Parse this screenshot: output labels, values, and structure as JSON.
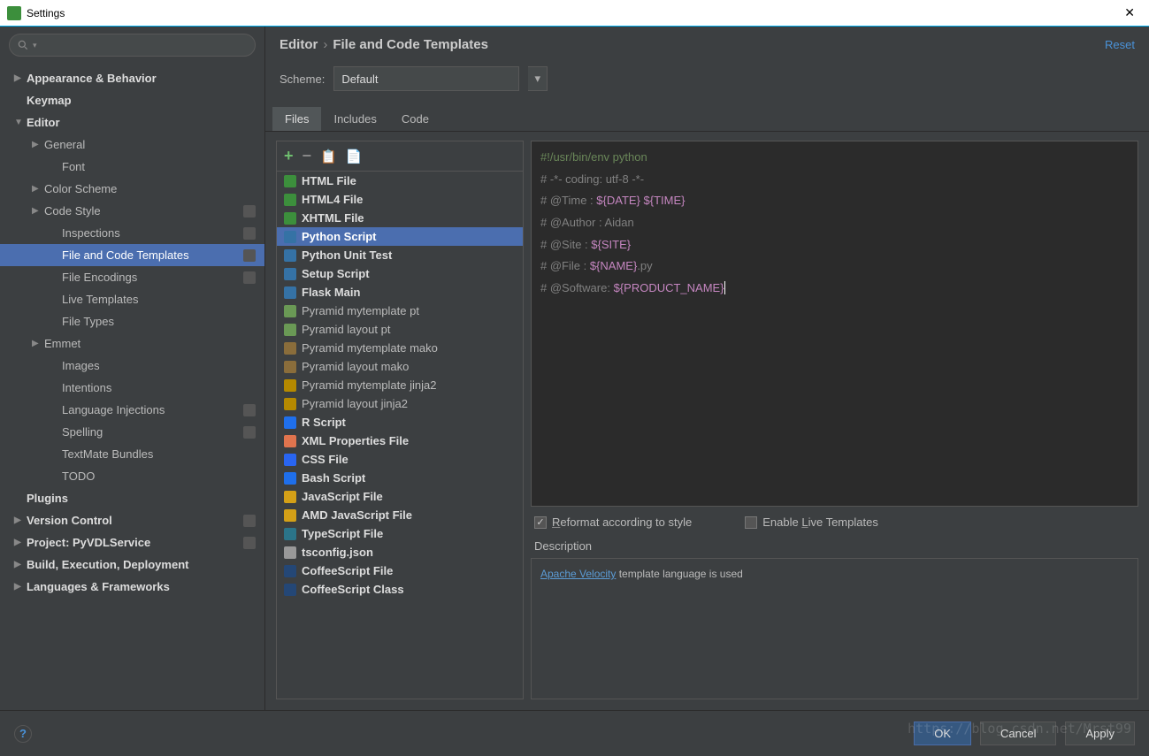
{
  "window": {
    "title": "Settings"
  },
  "search": {
    "placeholder": ""
  },
  "tree": [
    {
      "label": "Appearance & Behavior",
      "lvl": 1,
      "arrow": "▶",
      "bold": true
    },
    {
      "label": "Keymap",
      "lvl": 1,
      "arrow": "",
      "bold": true
    },
    {
      "label": "Editor",
      "lvl": 1,
      "arrow": "▼",
      "bold": true
    },
    {
      "label": "General",
      "lvl": 2,
      "arrow": "▶"
    },
    {
      "label": "Font",
      "lvl": 3,
      "arrow": ""
    },
    {
      "label": "Color Scheme",
      "lvl": 2,
      "arrow": "▶"
    },
    {
      "label": "Code Style",
      "lvl": 2,
      "arrow": "▶",
      "badge": true
    },
    {
      "label": "Inspections",
      "lvl": 3,
      "arrow": "",
      "badge": true
    },
    {
      "label": "File and Code Templates",
      "lvl": 3,
      "arrow": "",
      "badge": true,
      "selected": true
    },
    {
      "label": "File Encodings",
      "lvl": 3,
      "arrow": "",
      "badge": true
    },
    {
      "label": "Live Templates",
      "lvl": 3,
      "arrow": ""
    },
    {
      "label": "File Types",
      "lvl": 3,
      "arrow": ""
    },
    {
      "label": "Emmet",
      "lvl": 2,
      "arrow": "▶"
    },
    {
      "label": "Images",
      "lvl": 3,
      "arrow": ""
    },
    {
      "label": "Intentions",
      "lvl": 3,
      "arrow": ""
    },
    {
      "label": "Language Injections",
      "lvl": 3,
      "arrow": "",
      "badge": true
    },
    {
      "label": "Spelling",
      "lvl": 3,
      "arrow": "",
      "badge": true
    },
    {
      "label": "TextMate Bundles",
      "lvl": 3,
      "arrow": ""
    },
    {
      "label": "TODO",
      "lvl": 3,
      "arrow": ""
    },
    {
      "label": "Plugins",
      "lvl": 1,
      "arrow": "",
      "bold": true
    },
    {
      "label": "Version Control",
      "lvl": 1,
      "arrow": "▶",
      "bold": true,
      "badge": true
    },
    {
      "label": "Project: PyVDLService",
      "lvl": 1,
      "arrow": "▶",
      "bold": true,
      "badge": true
    },
    {
      "label": "Build, Execution, Deployment",
      "lvl": 1,
      "arrow": "▶",
      "bold": true
    },
    {
      "label": "Languages & Frameworks",
      "lvl": 1,
      "arrow": "▶",
      "bold": true
    }
  ],
  "breadcrumb": {
    "root": "Editor",
    "leaf": "File and Code Templates",
    "reset": "Reset"
  },
  "scheme": {
    "label": "Scheme:",
    "value": "Default"
  },
  "tabs": [
    {
      "label": "Files",
      "active": true
    },
    {
      "label": "Includes"
    },
    {
      "label": "Code"
    }
  ],
  "files": [
    {
      "label": "HTML File",
      "icon": "fi-h",
      "bold": true
    },
    {
      "label": "HTML4 File",
      "icon": "fi-h",
      "bold": true
    },
    {
      "label": "XHTML File",
      "icon": "fi-h",
      "bold": true
    },
    {
      "label": "Python Script",
      "icon": "fi-py",
      "bold": true,
      "selected": true
    },
    {
      "label": "Python Unit Test",
      "icon": "fi-py",
      "bold": true
    },
    {
      "label": "Setup Script",
      "icon": "fi-py",
      "bold": true
    },
    {
      "label": "Flask Main",
      "icon": "fi-py",
      "bold": true
    },
    {
      "label": "Pyramid mytemplate pt",
      "icon": "fi-c"
    },
    {
      "label": "Pyramid layout pt",
      "icon": "fi-c"
    },
    {
      "label": "Pyramid mytemplate mako",
      "icon": "fi-m"
    },
    {
      "label": "Pyramid layout mako",
      "icon": "fi-m"
    },
    {
      "label": "Pyramid mytemplate jinja2",
      "icon": "fi-j2"
    },
    {
      "label": "Pyramid layout jinja2",
      "icon": "fi-j2"
    },
    {
      "label": "R Script",
      "icon": "fi-r",
      "bold": true
    },
    {
      "label": "XML Properties File",
      "icon": "fi-xml",
      "bold": true
    },
    {
      "label": "CSS File",
      "icon": "fi-css",
      "bold": true
    },
    {
      "label": "Bash Script",
      "icon": "fi-sh",
      "bold": true
    },
    {
      "label": "JavaScript File",
      "icon": "fi-js",
      "bold": true
    },
    {
      "label": "AMD JavaScript File",
      "icon": "fi-js",
      "bold": true
    },
    {
      "label": "TypeScript File",
      "icon": "fi-ts",
      "bold": true
    },
    {
      "label": "tsconfig.json",
      "icon": "fi-json",
      "bold": true
    },
    {
      "label": "CoffeeScript File",
      "icon": "fi-coffee",
      "bold": true
    },
    {
      "label": "CoffeeScript Class",
      "icon": "fi-coffee",
      "bold": true
    }
  ],
  "editor_lines": [
    {
      "t": "sh",
      "text": "#!/usr/bin/env python"
    },
    {
      "t": "c",
      "text": "# -*- coding: utf-8 -*-"
    },
    {
      "t": "v",
      "prefix": "# @Time    : ",
      "var": "${DATE} ${TIME}"
    },
    {
      "t": "c",
      "text": "# @Author  : Aidan"
    },
    {
      "t": "v",
      "prefix": "# @Site    : ",
      "var": "${SITE}"
    },
    {
      "t": "v",
      "prefix": "# @File    : ",
      "var": "${NAME}",
      "suffix": ".py"
    },
    {
      "t": "v",
      "prefix": "# @Software: ",
      "var": "${PRODUCT_NAME}",
      "caret": true
    }
  ],
  "checks": {
    "reformat": "Reformat according to style",
    "live": "Enable Live Templates"
  },
  "description": {
    "label": "Description",
    "link": "Apache Velocity",
    "rest": " template language is used"
  },
  "buttons": {
    "ok": "OK",
    "cancel": "Cancel",
    "apply": "Apply"
  },
  "watermark": "https://blog.csdn.net/Mrst99"
}
